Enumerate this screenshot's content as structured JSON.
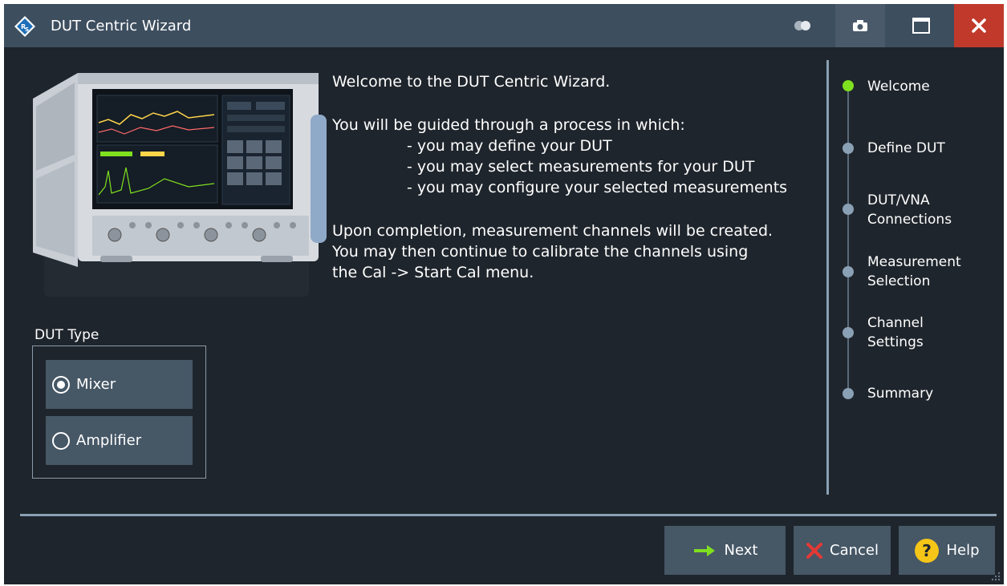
{
  "window": {
    "title": "DUT Centric Wizard",
    "icons": {
      "app": "rohde-schwarz-logo",
      "toggle": "display-toggle-icon",
      "camera": "camera-icon",
      "maximize": "maximize-icon",
      "close": "close-icon"
    }
  },
  "welcome": {
    "heading": "Welcome to the DUT Centric Wizard.",
    "intro": "You will be guided through a process in which:",
    "bullets": [
      "- you may define your DUT",
      "- you may select measurements for your DUT",
      "- you may configure your selected measurements"
    ],
    "completion_lines": [
      "Upon completion, measurement channels will be created.",
      "You may then continue to calibrate the channels using",
      "the Cal -> Start Cal menu."
    ]
  },
  "dut_type": {
    "label": "DUT Type",
    "options": [
      {
        "label": "Mixer",
        "selected": true
      },
      {
        "label": "Amplifier",
        "selected": false
      }
    ]
  },
  "steps": [
    {
      "label": "Welcome",
      "active": true
    },
    {
      "label": "Define DUT",
      "active": false
    },
    {
      "label": "DUT/VNA\nConnections",
      "active": false
    },
    {
      "label": "Measurement\nSelection",
      "active": false
    },
    {
      "label": "Channel\nSettings",
      "active": false
    },
    {
      "label": "Summary",
      "active": false
    }
  ],
  "buttons": {
    "next": "Next",
    "cancel": "Cancel",
    "help": "Help"
  },
  "colors": {
    "background": "#1f252c",
    "titlebar": "#3d4e5f",
    "button": "#465766",
    "close": "#c0392b",
    "active_step": "#7fe01f",
    "inactive_step": "#8aa0b4",
    "next_arrow": "#7fe01f",
    "cancel_x": "#e53935",
    "help_circle": "#f5c518"
  }
}
